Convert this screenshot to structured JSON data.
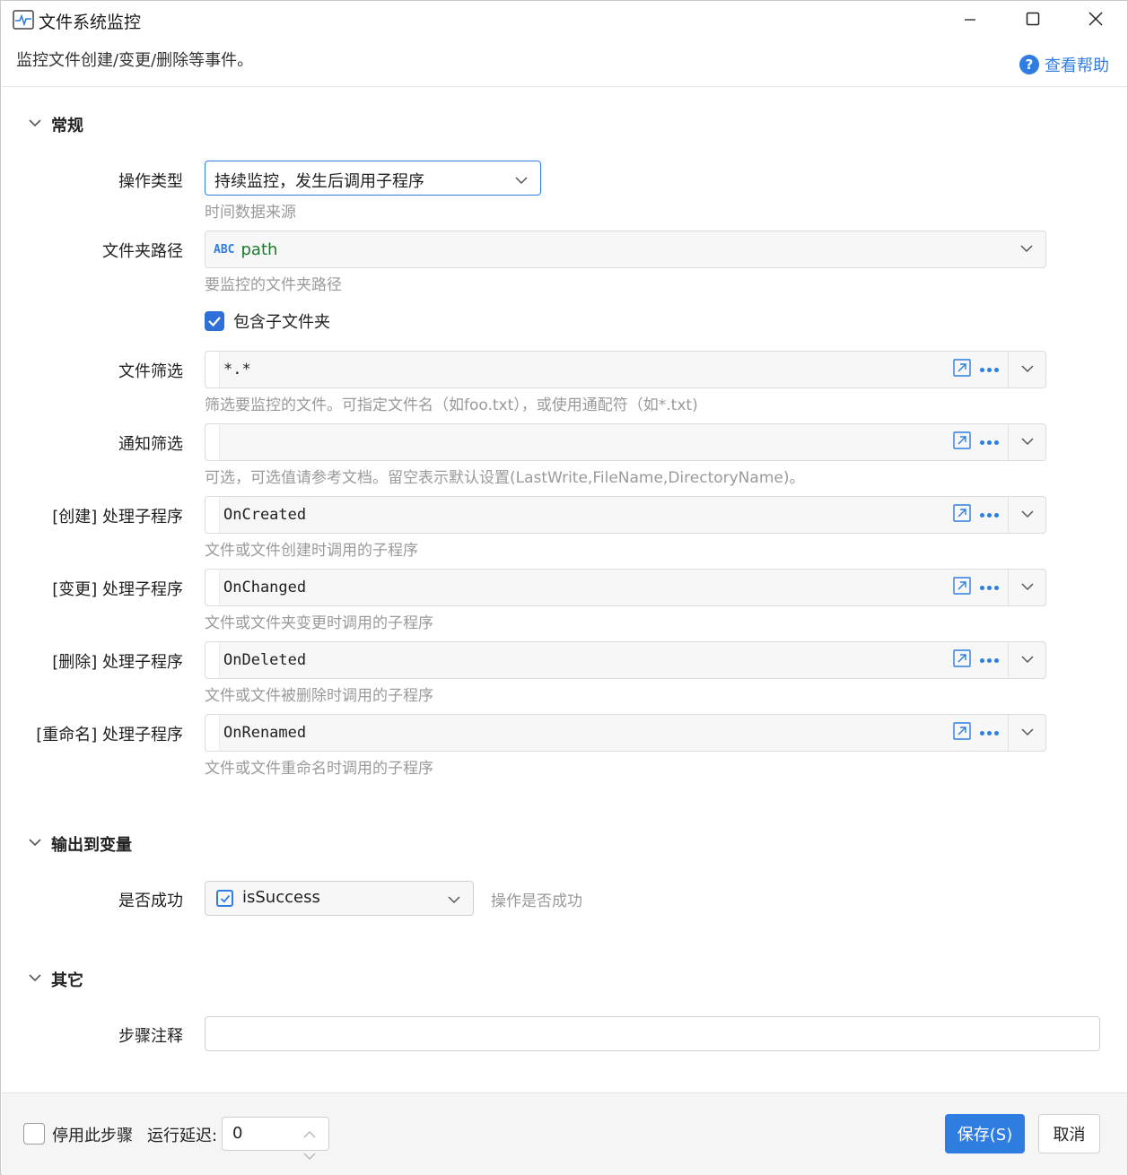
{
  "window": {
    "title": "文件系统监控",
    "subtitle": "监控文件创建/变更/删除等事件。",
    "help_label": "查看帮助"
  },
  "sections": {
    "general": "常规",
    "output": "输出到变量",
    "other": "其它"
  },
  "general": {
    "op_type": {
      "label": "操作类型",
      "value": "持续监控，发生后调用子程序",
      "hint": "时间数据来源"
    },
    "folder_path": {
      "label": "文件夹路径",
      "badge": "ABC",
      "value": "path",
      "hint": "要监控的文件夹路径"
    },
    "include_sub": {
      "label": "包含子文件夹",
      "checked": true
    },
    "file_filter": {
      "label": "文件筛选",
      "value": "*.*",
      "hint": "筛选要监控的文件。可指定文件名（如foo.txt），或使用通配符（如*.txt)"
    },
    "notify_filter": {
      "label": "通知筛选",
      "value": "",
      "hint": "可选，可选值请参考文档。留空表示默认设置(LastWrite,FileName,DirectoryName)。"
    },
    "on_created": {
      "label": "[创建] 处理子程序",
      "value": "OnCreated",
      "hint": "文件或文件创建时调用的子程序"
    },
    "on_changed": {
      "label": "[变更] 处理子程序",
      "value": "OnChanged",
      "hint": "文件或文件夹变更时调用的子程序"
    },
    "on_deleted": {
      "label": "[删除] 处理子程序",
      "value": "OnDeleted",
      "hint": "文件或文件被删除时调用的子程序"
    },
    "on_renamed": {
      "label": "[重命名] 处理子程序",
      "value": "OnRenamed",
      "hint": "文件或文件重命名时调用的子程序"
    }
  },
  "output": {
    "success": {
      "label": "是否成功",
      "value": "isSuccess",
      "hint": "操作是否成功"
    }
  },
  "other": {
    "note": {
      "label": "步骤注释",
      "value": ""
    }
  },
  "footer": {
    "disable_label": "停用此步骤",
    "disable_checked": false,
    "delay_label": "运行延迟:",
    "delay_value": "0",
    "save_label": "保存(S)",
    "cancel_label": "取消"
  },
  "colors": {
    "accent": "#2f7de1",
    "checkbox": "#2f6fd8",
    "hint_text": "#9a9a9a"
  },
  "icons": [
    "app-monitor-icon",
    "minimize-icon",
    "maximize-icon",
    "close-icon",
    "help-icon",
    "chevron-down-icon",
    "open-external-icon",
    "more-icon",
    "check-icon",
    "spin-up-icon",
    "spin-down-icon"
  ]
}
